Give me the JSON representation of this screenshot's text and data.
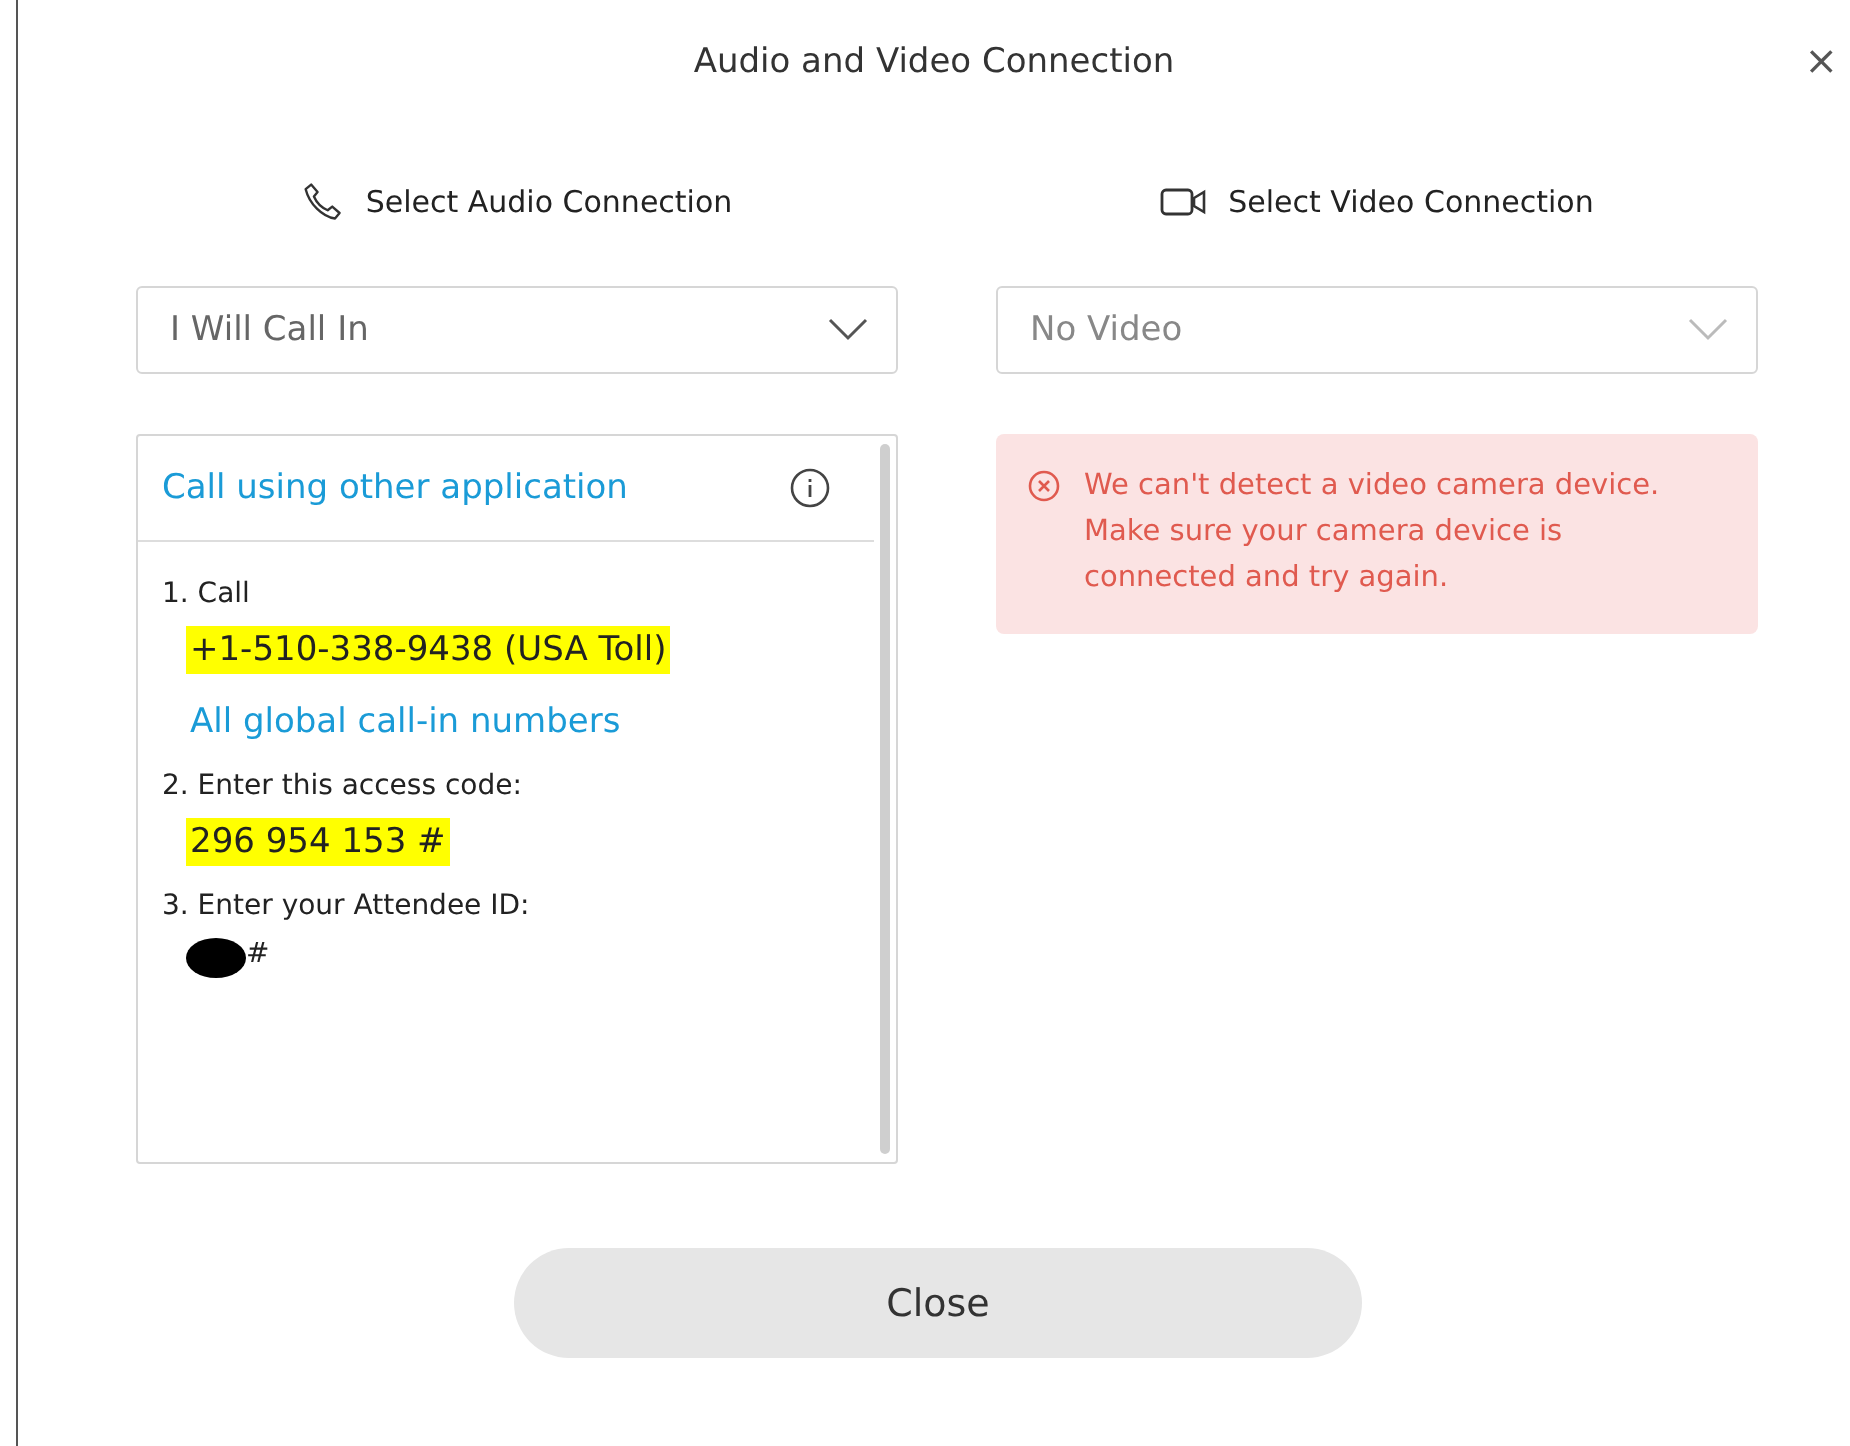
{
  "window": {
    "title": "Audio and Video Connection",
    "close": "×"
  },
  "audio": {
    "heading": "Select Audio Connection",
    "dropdown": {
      "value": "I Will Call In",
      "disabled": false
    },
    "panel": {
      "link": "Call using other application",
      "steps": [
        {
          "label": "1. Call",
          "lines": [
            {
              "kind": "number",
              "text": "+1-510-338-9438 (USA Toll)",
              "highlighted": true
            },
            {
              "kind": "link",
              "text": "All global call-in numbers",
              "highlighted": false
            }
          ]
        },
        {
          "label": "2. Enter this access code:",
          "lines": [
            {
              "kind": "number",
              "text": "296 954 153 #",
              "highlighted": true
            }
          ]
        },
        {
          "label": "3. Enter your Attendee ID:",
          "lines": [
            {
              "kind": "redacted",
              "text": "#",
              "highlighted": false
            }
          ]
        }
      ]
    }
  },
  "video": {
    "heading": "Select Video Connection",
    "dropdown": {
      "value": "No Video",
      "disabled": true
    },
    "error": "We can't detect a video camera device. Make sure your camera device is connected and try again."
  },
  "buttons": [
    "Close"
  ]
}
